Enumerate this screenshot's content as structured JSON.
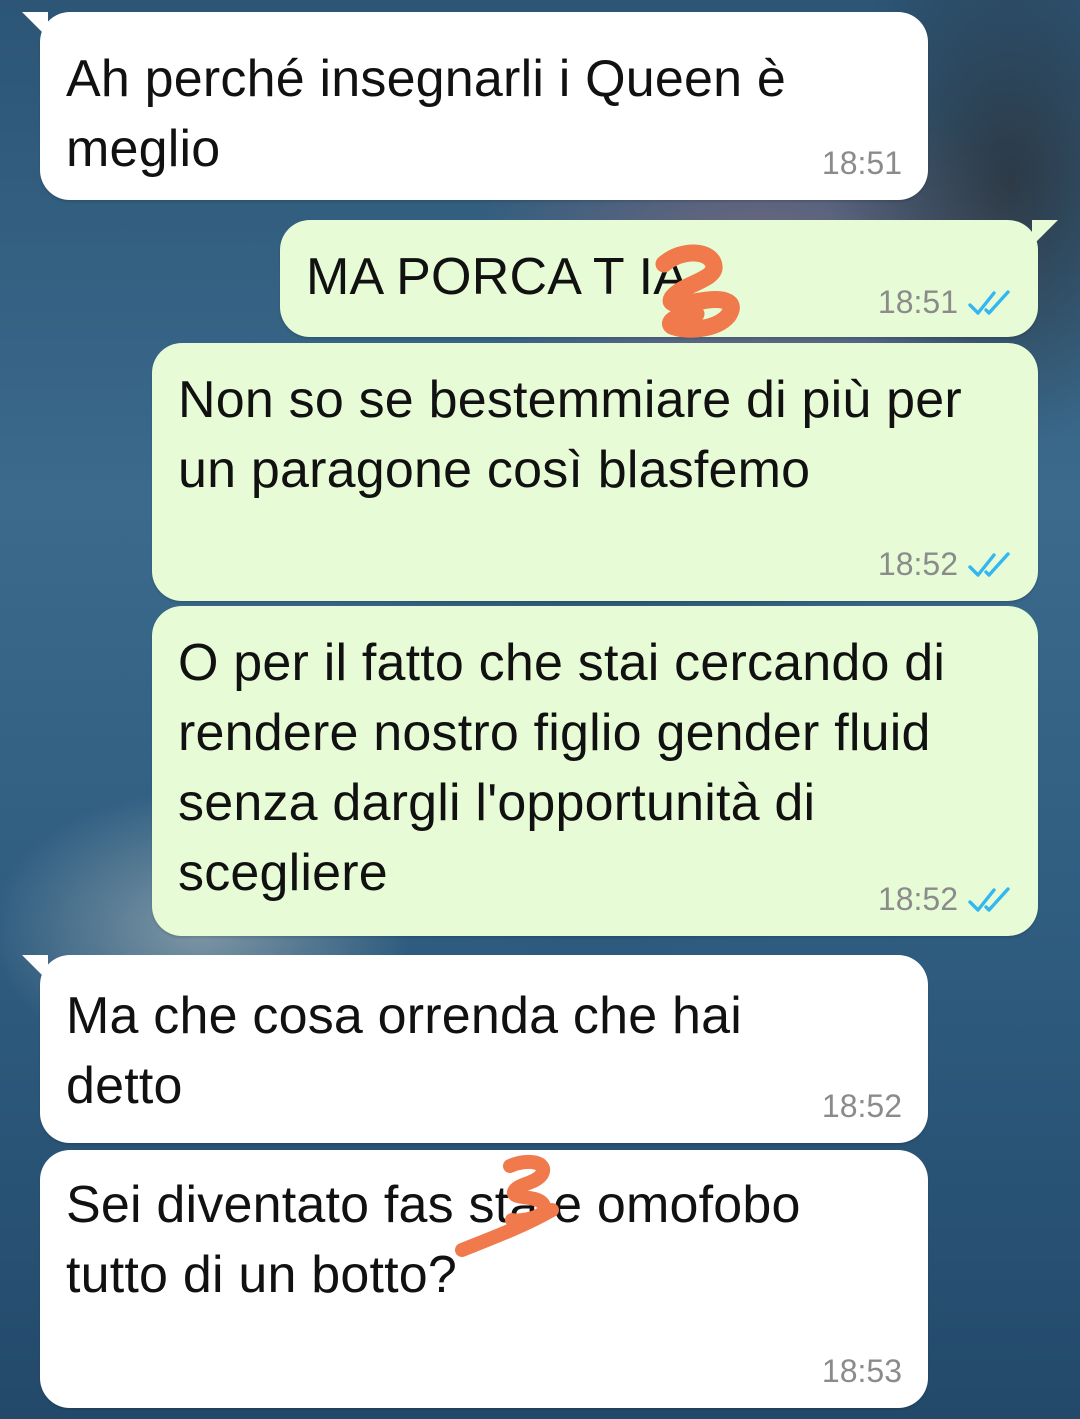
{
  "messages": [
    {
      "direction": "incoming",
      "text": "Ah perché insegnarli i Queen è meglio",
      "time": "18:51"
    },
    {
      "direction": "outgoing",
      "text": "MA PORCA T  IA",
      "time": "18:51",
      "status": "read-double-check-icon"
    },
    {
      "direction": "outgoing",
      "text": "Non so se bestemmiare di più per un paragone così blasfemo",
      "time": "18:52",
      "status": "read-double-check-icon"
    },
    {
      "direction": "outgoing",
      "text": "O per il fatto che stai cercando di rendere nostro figlio gender fluid senza dargli l'opportunità di scegliere",
      "time": "18:52",
      "status": "read-double-check-icon"
    },
    {
      "direction": "incoming",
      "text": "Ma che cosa orrenda che hai detto",
      "time": "18:52"
    },
    {
      "direction": "incoming",
      "text": "Sei diventato fas   sta e omofobo tutto di un botto?",
      "time": "18:53"
    }
  ],
  "colors": {
    "incoming_bubble": "#ffffff",
    "outgoing_bubble": "#e7fcd6",
    "read_ticks": "#34b7f1",
    "redaction": "#f07a4c"
  }
}
